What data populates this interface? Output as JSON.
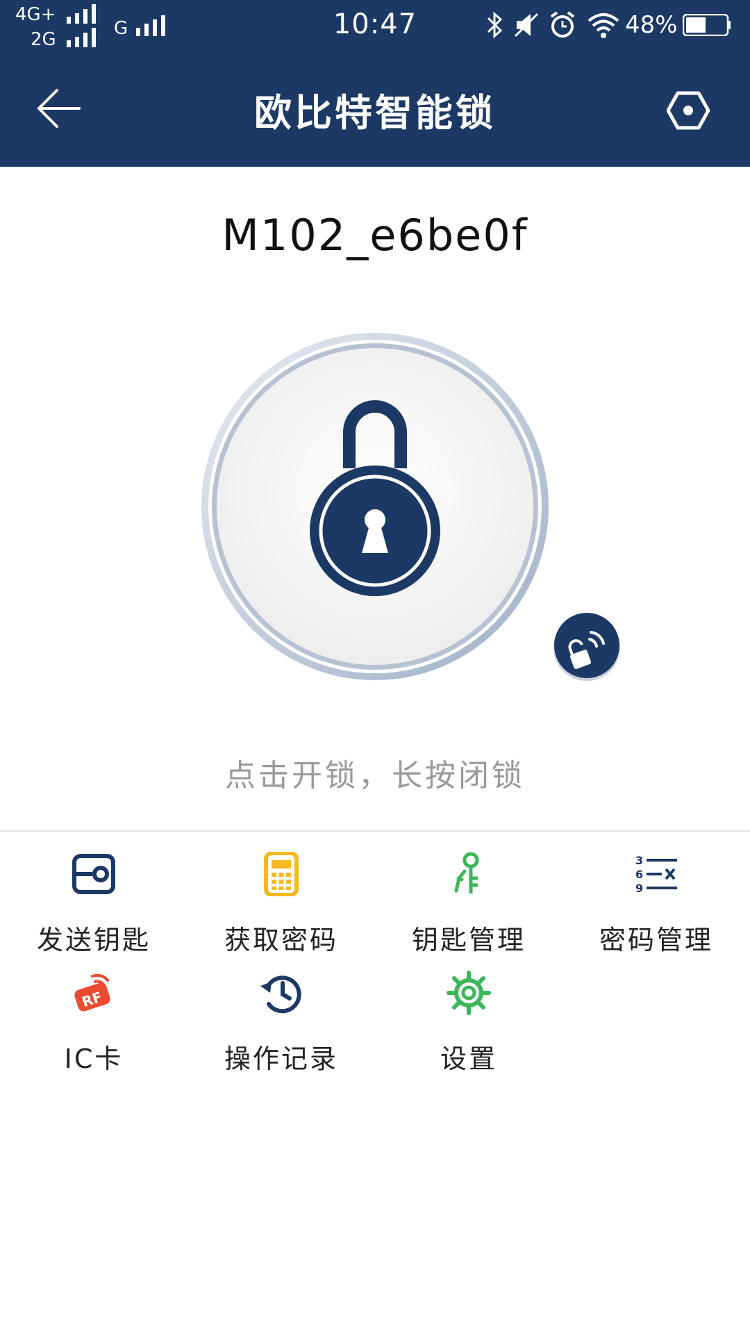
{
  "status_bar": {
    "network_top": "4G+",
    "network_bottom": "2G",
    "network_g": "G",
    "time": "10:47",
    "battery": "48%"
  },
  "header": {
    "title": "欧比特智能锁",
    "back_icon": "arrow-left-icon",
    "right_icon": "hexagon-icon"
  },
  "device": {
    "name": "M102_e6be0f"
  },
  "lock": {
    "hint": "点击开锁，长按闭锁"
  },
  "menu": [
    {
      "label": "发送钥匙",
      "icon": "send-key-icon",
      "color": "#1c3864"
    },
    {
      "label": "获取密码",
      "icon": "calculator-icon",
      "color": "#f5b921"
    },
    {
      "label": "钥匙管理",
      "icon": "keys-icon",
      "color": "#3cb55a"
    },
    {
      "label": "密码管理",
      "icon": "password-list-icon",
      "color": "#1c3864"
    },
    {
      "label": "IC卡",
      "icon": "rf-card-icon",
      "color": "#e94b2e"
    },
    {
      "label": "操作记录",
      "icon": "history-icon",
      "color": "#1c3864"
    },
    {
      "label": "设置",
      "icon": "gear-icon",
      "color": "#3cb55a"
    }
  ],
  "colors": {
    "header_bg": "#1c3864",
    "hint_text": "#9a9a9a"
  }
}
